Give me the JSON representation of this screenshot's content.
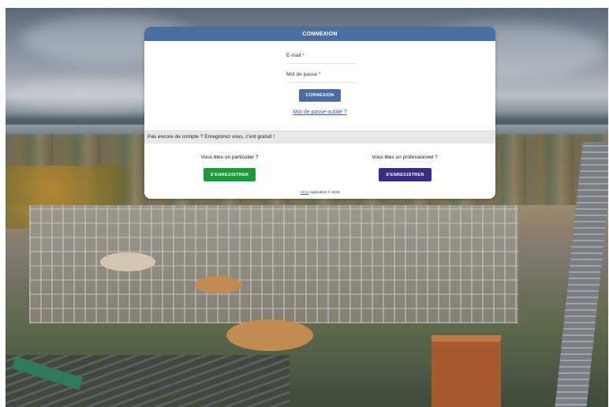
{
  "login": {
    "header_title": "CONNEXION",
    "email_label": "E-mail",
    "password_label": "Mot de passe",
    "required_marker": "*",
    "login_button": "CONNEXION",
    "forgot_link": "Mot de passe oublié ?"
  },
  "register": {
    "bar_text": "Pas encore de compte ? Enregistrez vous, c'est gratuit !",
    "individual_question": "Vous êtes un particulier ?",
    "individual_button": "S'ENREGISTRER",
    "professional_question": "Vous êtes un professionnel ?",
    "professional_button": "S'ENREGISTRER"
  },
  "footer": {
    "brand": "Strop",
    "text": "Application © 2019"
  },
  "colors": {
    "header_blue": "#4a6ea1",
    "individual_green": "#1a9b3a",
    "professional_purple": "#3a2d86",
    "required_red": "#e02020"
  }
}
